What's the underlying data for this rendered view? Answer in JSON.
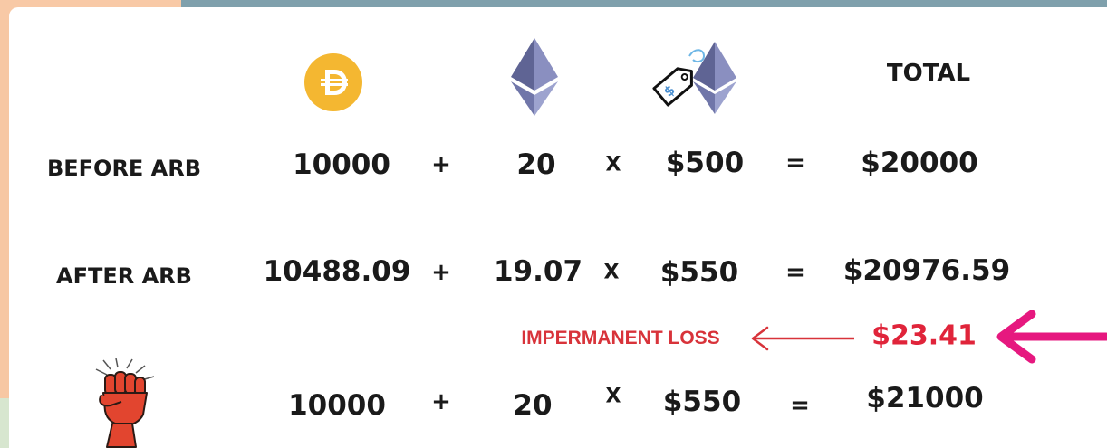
{
  "header": {
    "total_label": "TOTAL",
    "icons": [
      "dai-coin-icon",
      "ethereum-icon",
      "eth-price-tag-icon"
    ]
  },
  "rows": [
    {
      "label": "BEFORE ARB",
      "dai": "10000",
      "plus": "+",
      "eth": "20",
      "times": "X",
      "price": "$500",
      "equals": "=",
      "total": "$20000"
    },
    {
      "label": "AFTER ARB",
      "dai": "10488.09",
      "plus": "+",
      "eth": "19.07",
      "times": "X",
      "price": "$550",
      "equals": "=",
      "total": "$20976.59"
    },
    {
      "label_icon": "raised-fist-icon",
      "dai": "10000",
      "plus": "+",
      "eth": "20",
      "times": "X",
      "price": "$550",
      "equals": "=",
      "total": "$21000"
    }
  ],
  "loss": {
    "label": "IMPERMANENT LOSS",
    "value": "$23.41"
  },
  "colors": {
    "dai": "#f4b731",
    "eth_dark": "#5f6494",
    "eth_light": "#9da3cf",
    "loss_red": "#d8333a",
    "arrow_pink": "#e6187f",
    "fist_red": "#e2452f",
    "frame_teal": "#7fa0ac",
    "frame_peach": "#f8c9a6"
  }
}
